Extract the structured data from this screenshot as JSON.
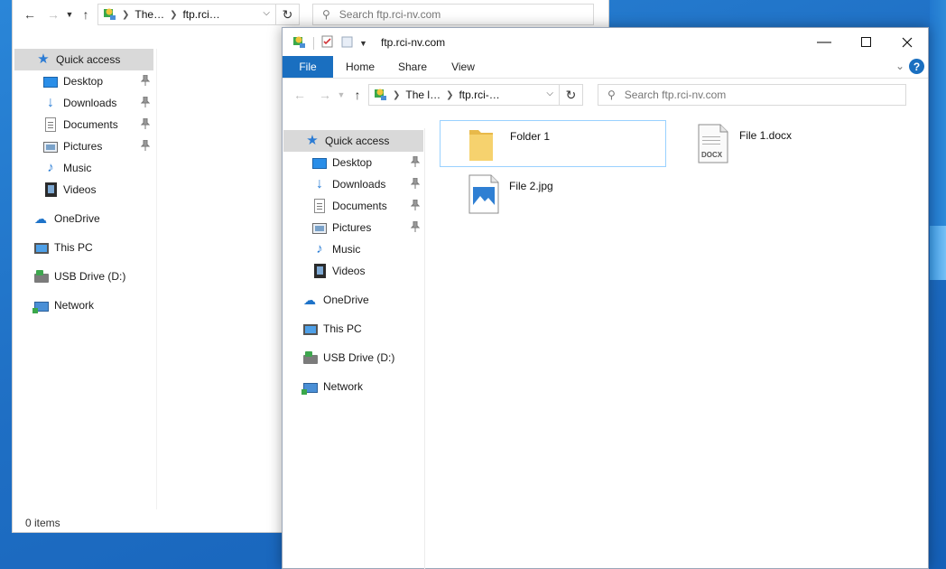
{
  "back_window": {
    "address": {
      "crumb1": "The…",
      "crumb2": "ftp.rci…"
    },
    "search": {
      "placeholder": "Search ftp.rci-nv.com"
    },
    "nav": {
      "quick_access": "Quick access",
      "items": [
        {
          "label": "Desktop",
          "icon": "desktop-icon",
          "pinned": true
        },
        {
          "label": "Downloads",
          "icon": "downloads-icon",
          "pinned": true
        },
        {
          "label": "Documents",
          "icon": "documents-icon",
          "pinned": true
        },
        {
          "label": "Pictures",
          "icon": "pictures-icon",
          "pinned": true
        },
        {
          "label": "Music",
          "icon": "music-icon",
          "pinned": false
        },
        {
          "label": "Videos",
          "icon": "videos-icon",
          "pinned": false
        }
      ],
      "onedrive": "OneDrive",
      "this_pc": "This PC",
      "usb": "USB Drive (D:)",
      "network": "Network"
    },
    "status": "0 items"
  },
  "front_window": {
    "title": "ftp.rci-nv.com",
    "tabs": {
      "file": "File",
      "home": "Home",
      "share": "Share",
      "view": "View"
    },
    "address": {
      "crumb1": "The l…",
      "crumb2": "ftp.rci-…"
    },
    "search": {
      "placeholder": "Search ftp.rci-nv.com"
    },
    "nav": {
      "quick_access": "Quick access",
      "items": [
        {
          "label": "Desktop",
          "icon": "desktop-icon",
          "pinned": true
        },
        {
          "label": "Downloads",
          "icon": "downloads-icon",
          "pinned": true
        },
        {
          "label": "Documents",
          "icon": "documents-icon",
          "pinned": true
        },
        {
          "label": "Pictures",
          "icon": "pictures-icon",
          "pinned": true
        },
        {
          "label": "Music",
          "icon": "music-icon",
          "pinned": false
        },
        {
          "label": "Videos",
          "icon": "videos-icon",
          "pinned": false
        }
      ],
      "onedrive": "OneDrive",
      "this_pc": "This PC",
      "usb": "USB Drive (D:)",
      "network": "Network"
    },
    "files": [
      {
        "name": "Folder 1",
        "type": "folder-icon",
        "selected": true
      },
      {
        "name": "File 1.docx",
        "type": "docx-icon",
        "badge": "DOCX"
      },
      {
        "name": "File 2.jpg",
        "type": "image-file-icon"
      }
    ]
  },
  "colors": {
    "accent": "#1a6fc0",
    "selection": "#99d1ff",
    "wallpaper": "#1f6fc4"
  }
}
